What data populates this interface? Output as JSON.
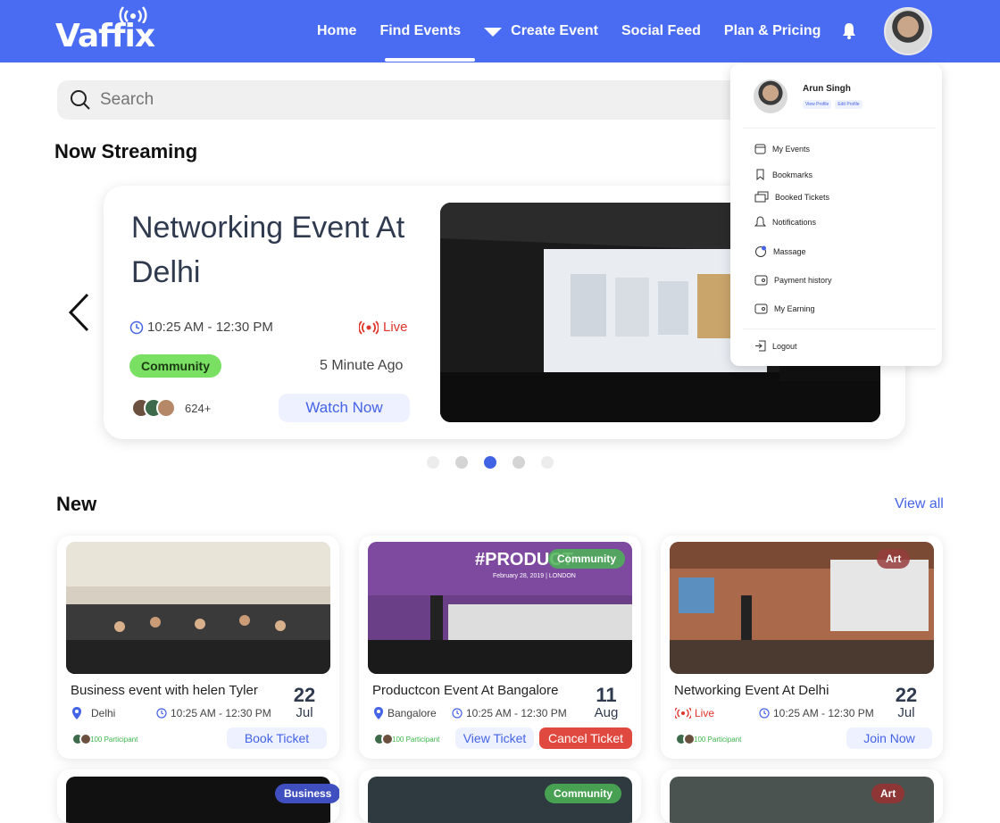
{
  "brand": {
    "name": "Vaffix",
    "accent": "#4a6cf2"
  },
  "nav": {
    "items": [
      {
        "label": "Home"
      },
      {
        "label": "Find Events"
      },
      {
        "label": "Create Event"
      },
      {
        "label": "Social Feed"
      },
      {
        "label": "Plan & Pricing"
      }
    ],
    "active": "Find Events"
  },
  "search": {
    "placeholder": "Search"
  },
  "streaming": {
    "section_title": "Now Streaming",
    "title": "Networking Event At Delhi",
    "time": "10:25 AM - 12:30 PM",
    "live": "Live",
    "tag": "Community",
    "ago": "5 Minute Ago",
    "count": "624+",
    "cta": "Watch Now",
    "active_slide": 3
  },
  "new_section": {
    "title": "New",
    "view_all": "View all"
  },
  "events": [
    {
      "title": "Business event with helen Tyler",
      "day": "22",
      "month": "Jul",
      "location": "Delhi",
      "time": "10:25 AM - 12:30 PM",
      "participants": "100 Participant",
      "buttons": [
        "Book Ticket"
      ]
    },
    {
      "title": "Productcon Event At Bangalore",
      "day": "11",
      "month": "Aug",
      "location": "Bangalore",
      "time": "10:25 AM - 12:30 PM",
      "participants": "100 Participant",
      "tag": "Community",
      "buttons": [
        "View Ticket",
        "Cancel Ticket"
      ],
      "banner": "#PRODUCT",
      "banner_sub": "February 28, 2019 | LONDON"
    },
    {
      "title": "Networking Event At Delhi",
      "day": "22",
      "month": "Jul",
      "location": "Live",
      "time": "10:25 AM - 12:30 PM",
      "participants": "100 Participant",
      "tag": "Art",
      "buttons": [
        "Join Now"
      ]
    }
  ],
  "events_row2_tags": [
    "Business",
    "Community",
    "Art"
  ],
  "profile_menu": {
    "name": "Arun Singh",
    "links": [
      "View Profile",
      "Edit Profile"
    ],
    "items": [
      {
        "label": "My Events",
        "icon": "calendar-icon"
      },
      {
        "label": "Bookmarks",
        "icon": "bookmark-icon"
      },
      {
        "label": "Booked Tickets",
        "icon": "tickets-icon"
      },
      {
        "label": "Notifications",
        "icon": "bell-icon"
      },
      {
        "label": "Massage",
        "icon": "chat-icon"
      },
      {
        "label": "Payment history",
        "icon": "wallet-icon"
      },
      {
        "label": "My Earning",
        "icon": "wallet-icon"
      }
    ],
    "logout": "Logout"
  }
}
